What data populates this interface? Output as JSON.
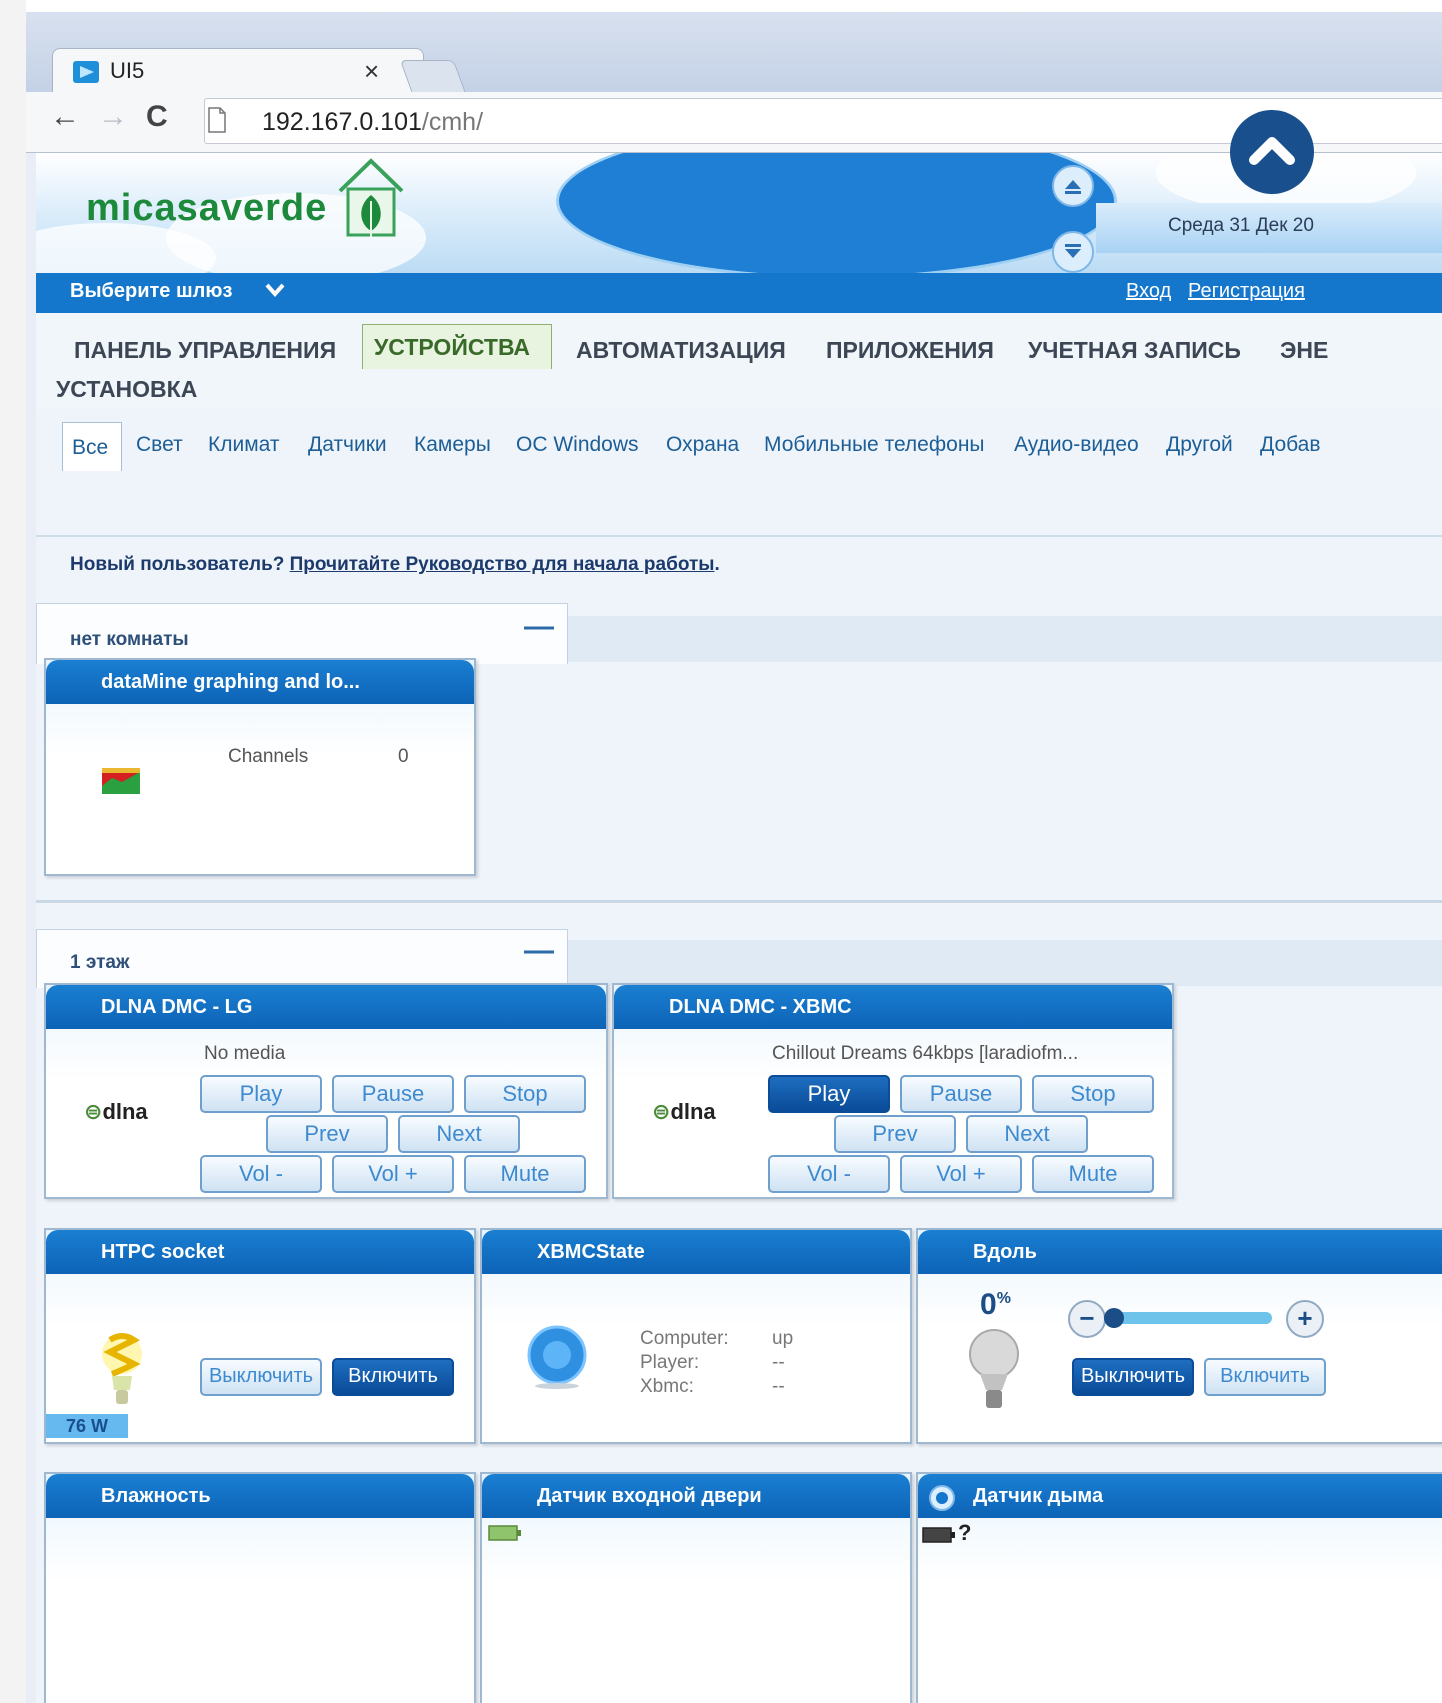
{
  "browser": {
    "tab_title": "UI5",
    "tab_close": "×",
    "url_host": "192.167.0.101",
    "url_path": "/cmh/",
    "back": "←",
    "forward": "→",
    "reload": "C"
  },
  "header": {
    "logo_text": "micasaverde",
    "date_text": "Среда 31 Дек 20"
  },
  "gateway_bar": {
    "select_gateway": "Выберите шлюз",
    "login": "Вход",
    "register": "Регистрация"
  },
  "main_menu": [
    {
      "label": "ПАНЕЛЬ УПРАВЛЕНИЯ"
    },
    {
      "label": "УСТРОЙСТВА"
    },
    {
      "label": "АВТОМАТИЗАЦИЯ"
    },
    {
      "label": "ПРИЛОЖЕНИЯ"
    },
    {
      "label": "УЧЕТНАЯ ЗАПИСЬ"
    },
    {
      "label": "ЭНЕ"
    },
    {
      "label": "УСТАНОВКА"
    }
  ],
  "sub_menu": [
    {
      "label": "Все"
    },
    {
      "label": "Свет"
    },
    {
      "label": "Климат"
    },
    {
      "label": "Датчики"
    },
    {
      "label": "Камеры"
    },
    {
      "label": "ОС Windows"
    },
    {
      "label": "Охрана"
    },
    {
      "label": "Мобильные телефоны"
    },
    {
      "label": "Аудио-видео"
    },
    {
      "label": "Другой"
    },
    {
      "label": "Добав"
    }
  ],
  "notice": {
    "prefix": "Новый пользователь?",
    "link": "Прочитайте Руководство для начала работы",
    "suffix": "."
  },
  "rooms": {
    "no_room": {
      "label": "нет комнаты",
      "toggle": "—"
    },
    "floor1": {
      "label": "1 этаж",
      "toggle": "—"
    }
  },
  "cards": {
    "datamine": {
      "title": "dataMine graphing and lo...",
      "channels_label": "Channels",
      "channels_value": "0"
    },
    "dlna_lg": {
      "title": "DLNA DMC - LG",
      "status": "No media",
      "logo": "dlna",
      "buttons": {
        "play": "Play",
        "pause": "Pause",
        "stop": "Stop",
        "prev": "Prev",
        "next": "Next",
        "voldown": "Vol -",
        "volup": "Vol +",
        "mute": "Mute"
      }
    },
    "dlna_xbmc": {
      "title": "DLNA DMC - XBMC",
      "status": "Chillout Dreams 64kbps [laradiofm...",
      "logo": "dlna",
      "buttons": {
        "play": "Play",
        "pause": "Pause",
        "stop": "Stop",
        "prev": "Prev",
        "next": "Next",
        "voldown": "Vol -",
        "volup": "Vol +",
        "mute": "Mute"
      }
    },
    "htpc": {
      "title": "HTPC socket",
      "off": "Выключить",
      "on": "Включить",
      "power": "76 W"
    },
    "xbmcstate": {
      "title": "XBMCState",
      "computer_label": "Computer:",
      "computer_value": "up",
      "player_label": "Player:",
      "player_value": "--",
      "xbmc_label": "Xbmc:",
      "xbmc_value": "--"
    },
    "vdol": {
      "title": "Вдоль",
      "level": "0",
      "level_unit": "%",
      "off": "Выключить",
      "on": "Включить",
      "minus": "−",
      "plus": "+"
    },
    "humidity": {
      "title": "Влажность"
    },
    "door": {
      "title": "Датчик входной двери"
    },
    "smoke": {
      "title": "Датчик дыма",
      "status": "?"
    }
  },
  "colors": {
    "brand_blue": "#1477cc",
    "card_header": "#0d63b6",
    "logo_green": "#1d8a3b",
    "scroll_button": "#1a4f8e"
  }
}
